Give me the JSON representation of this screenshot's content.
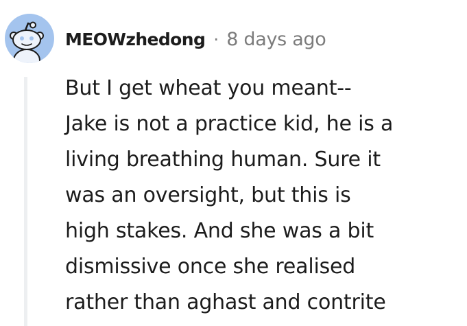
{
  "comment": {
    "author": "MEOWzhedong",
    "separator": "·",
    "timestamp": "8 days ago",
    "avatar_icon": "reddit-snoo-avatar-icon",
    "colors": {
      "avatar_background": "#a4c4ee",
      "text": "#1c1c1c",
      "meta": "#7c7c7c",
      "thread_line": "#edeff1"
    },
    "body_lines": [
      "But I get wheat you meant--",
      "Jake is not a practice kid, he is a",
      "living breathing human. Sure it",
      "was an oversight, but this is",
      "high stakes. And she was a bit",
      "dismissive once she realised",
      "rather than aghast and contrite"
    ]
  }
}
